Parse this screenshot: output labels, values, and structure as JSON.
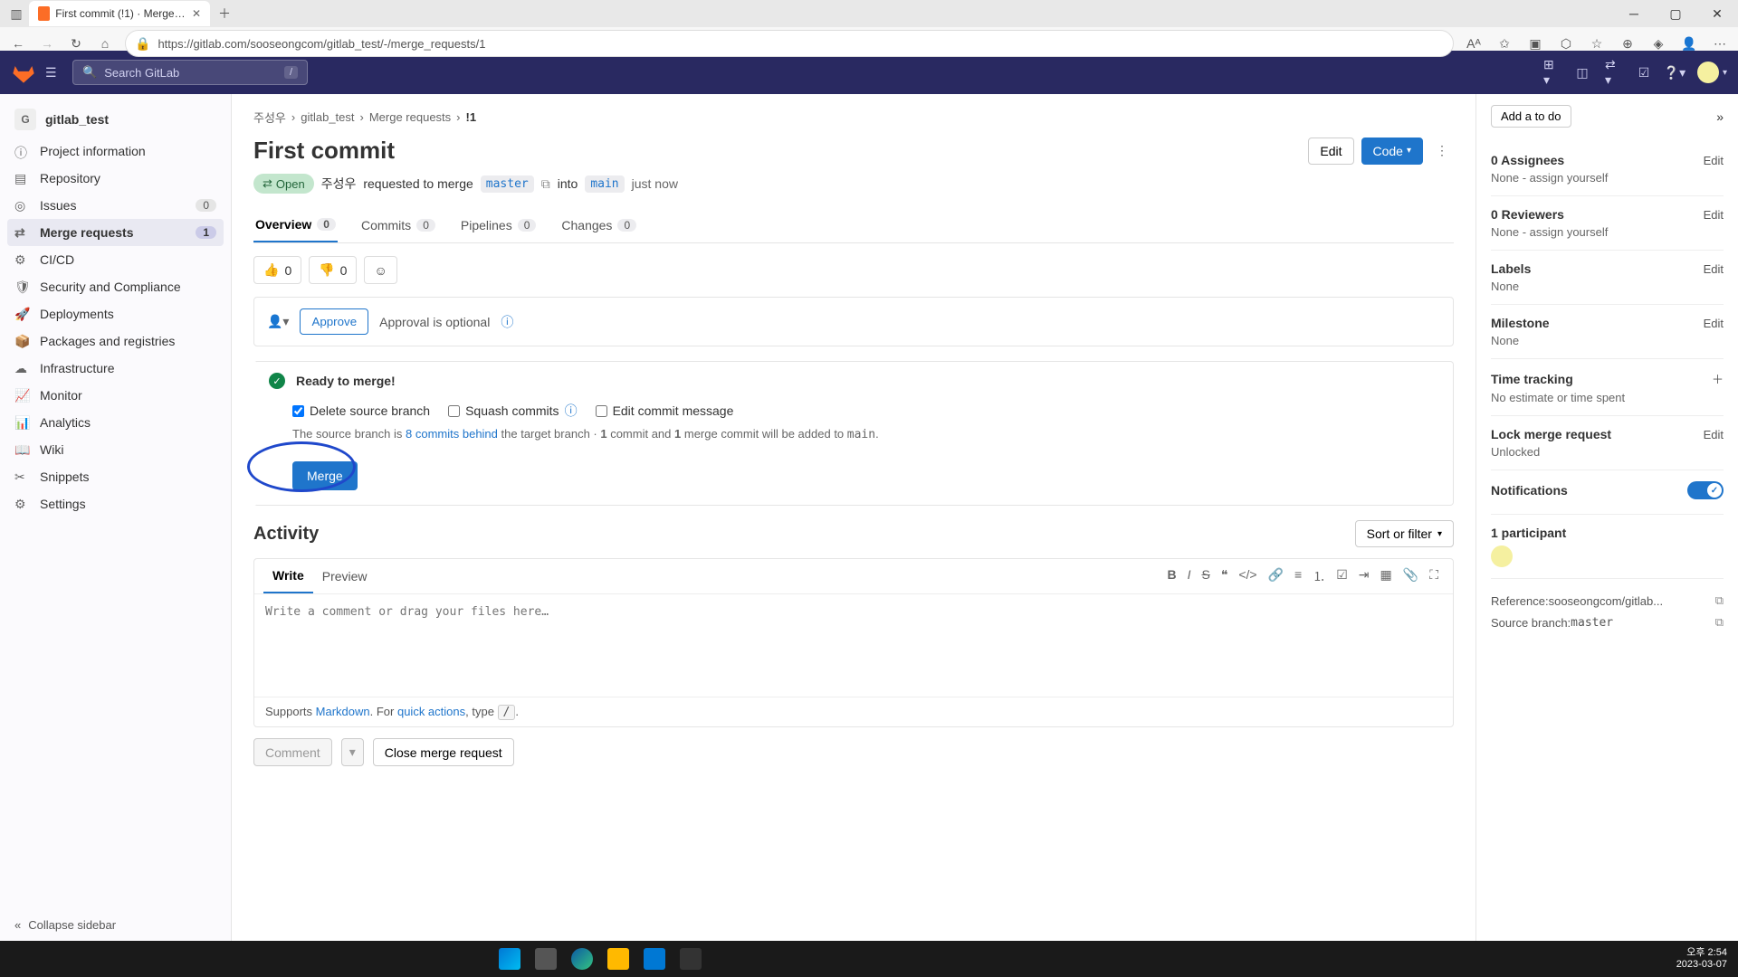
{
  "browser": {
    "tab_title": "First commit (!1) · Merge request",
    "url": "https://gitlab.com/sooseongcom/gitlab_test/-/merge_requests/1"
  },
  "topbar": {
    "search_placeholder": "Search GitLab",
    "search_kbd": "/"
  },
  "project": {
    "avatar_letter": "G",
    "name": "gitlab_test"
  },
  "sidebar": {
    "items": [
      {
        "label": "Project information"
      },
      {
        "label": "Repository"
      },
      {
        "label": "Issues",
        "badge": "0"
      },
      {
        "label": "Merge requests",
        "badge": "1"
      },
      {
        "label": "CI/CD"
      },
      {
        "label": "Security and Compliance"
      },
      {
        "label": "Deployments"
      },
      {
        "label": "Packages and registries"
      },
      {
        "label": "Infrastructure"
      },
      {
        "label": "Monitor"
      },
      {
        "label": "Analytics"
      },
      {
        "label": "Wiki"
      },
      {
        "label": "Snippets"
      },
      {
        "label": "Settings"
      }
    ],
    "collapse": "Collapse sidebar"
  },
  "crumbs": {
    "c0": "주성우",
    "c1": "gitlab_test",
    "c2": "Merge requests",
    "c3": "!1"
  },
  "mr": {
    "title": "First commit",
    "edit": "Edit",
    "code": "Code",
    "state": "Open",
    "author": "주성우",
    "req_text": "requested to merge",
    "src_branch": "master",
    "into": "into",
    "tgt_branch": "main",
    "time": "just now"
  },
  "tabs": {
    "overview": "Overview",
    "overview_c": "0",
    "commits": "Commits",
    "commits_c": "0",
    "pipelines": "Pipelines",
    "pipelines_c": "0",
    "changes": "Changes",
    "changes_c": "0"
  },
  "reactions": {
    "up": "0",
    "down": "0"
  },
  "approve": {
    "btn": "Approve",
    "text": "Approval is optional"
  },
  "merge": {
    "ready": "Ready to merge!",
    "delete_cb": "Delete source branch",
    "squash_cb": "Squash commits",
    "edit_cb": "Edit commit message",
    "behind_pre": "The source branch is ",
    "behind_link": "8 commits behind",
    "behind_post": " the target branch · ",
    "one1": "1",
    "commit_and": " commit and ",
    "one2": "1",
    "merge_added": " merge commit will be added to ",
    "tgt": "main",
    "btn": "Merge"
  },
  "activity": {
    "title": "Activity",
    "sort": "Sort or filter"
  },
  "editor": {
    "write": "Write",
    "preview": "Preview",
    "placeholder": "Write a comment or drag your files here…",
    "supports": "Supports ",
    "markdown": "Markdown",
    "for": ". For ",
    "quick": "quick actions",
    "type": ", type ",
    "slash": "/",
    "comment": "Comment",
    "close": "Close merge request"
  },
  "rightbar": {
    "add_todo": "Add a to do",
    "assignees": {
      "h": "0 Assignees",
      "b": "None - assign yourself",
      "e": "Edit"
    },
    "reviewers": {
      "h": "0 Reviewers",
      "b": "None - assign yourself",
      "e": "Edit"
    },
    "labels": {
      "h": "Labels",
      "b": "None",
      "e": "Edit"
    },
    "milestone": {
      "h": "Milestone",
      "b": "None",
      "e": "Edit"
    },
    "time": {
      "h": "Time tracking",
      "b": "No estimate or time spent"
    },
    "lock": {
      "h": "Lock merge request",
      "b": "Unlocked",
      "e": "Edit"
    },
    "notif": {
      "h": "Notifications"
    },
    "part": {
      "h": "1 participant"
    },
    "ref": {
      "label": "Reference: ",
      "val": "sooseongcom/gitlab..."
    },
    "src": {
      "label": "Source branch: ",
      "val": "master"
    }
  },
  "taskbar": {
    "time": "오후 2:54",
    "date": "2023-03-07"
  }
}
